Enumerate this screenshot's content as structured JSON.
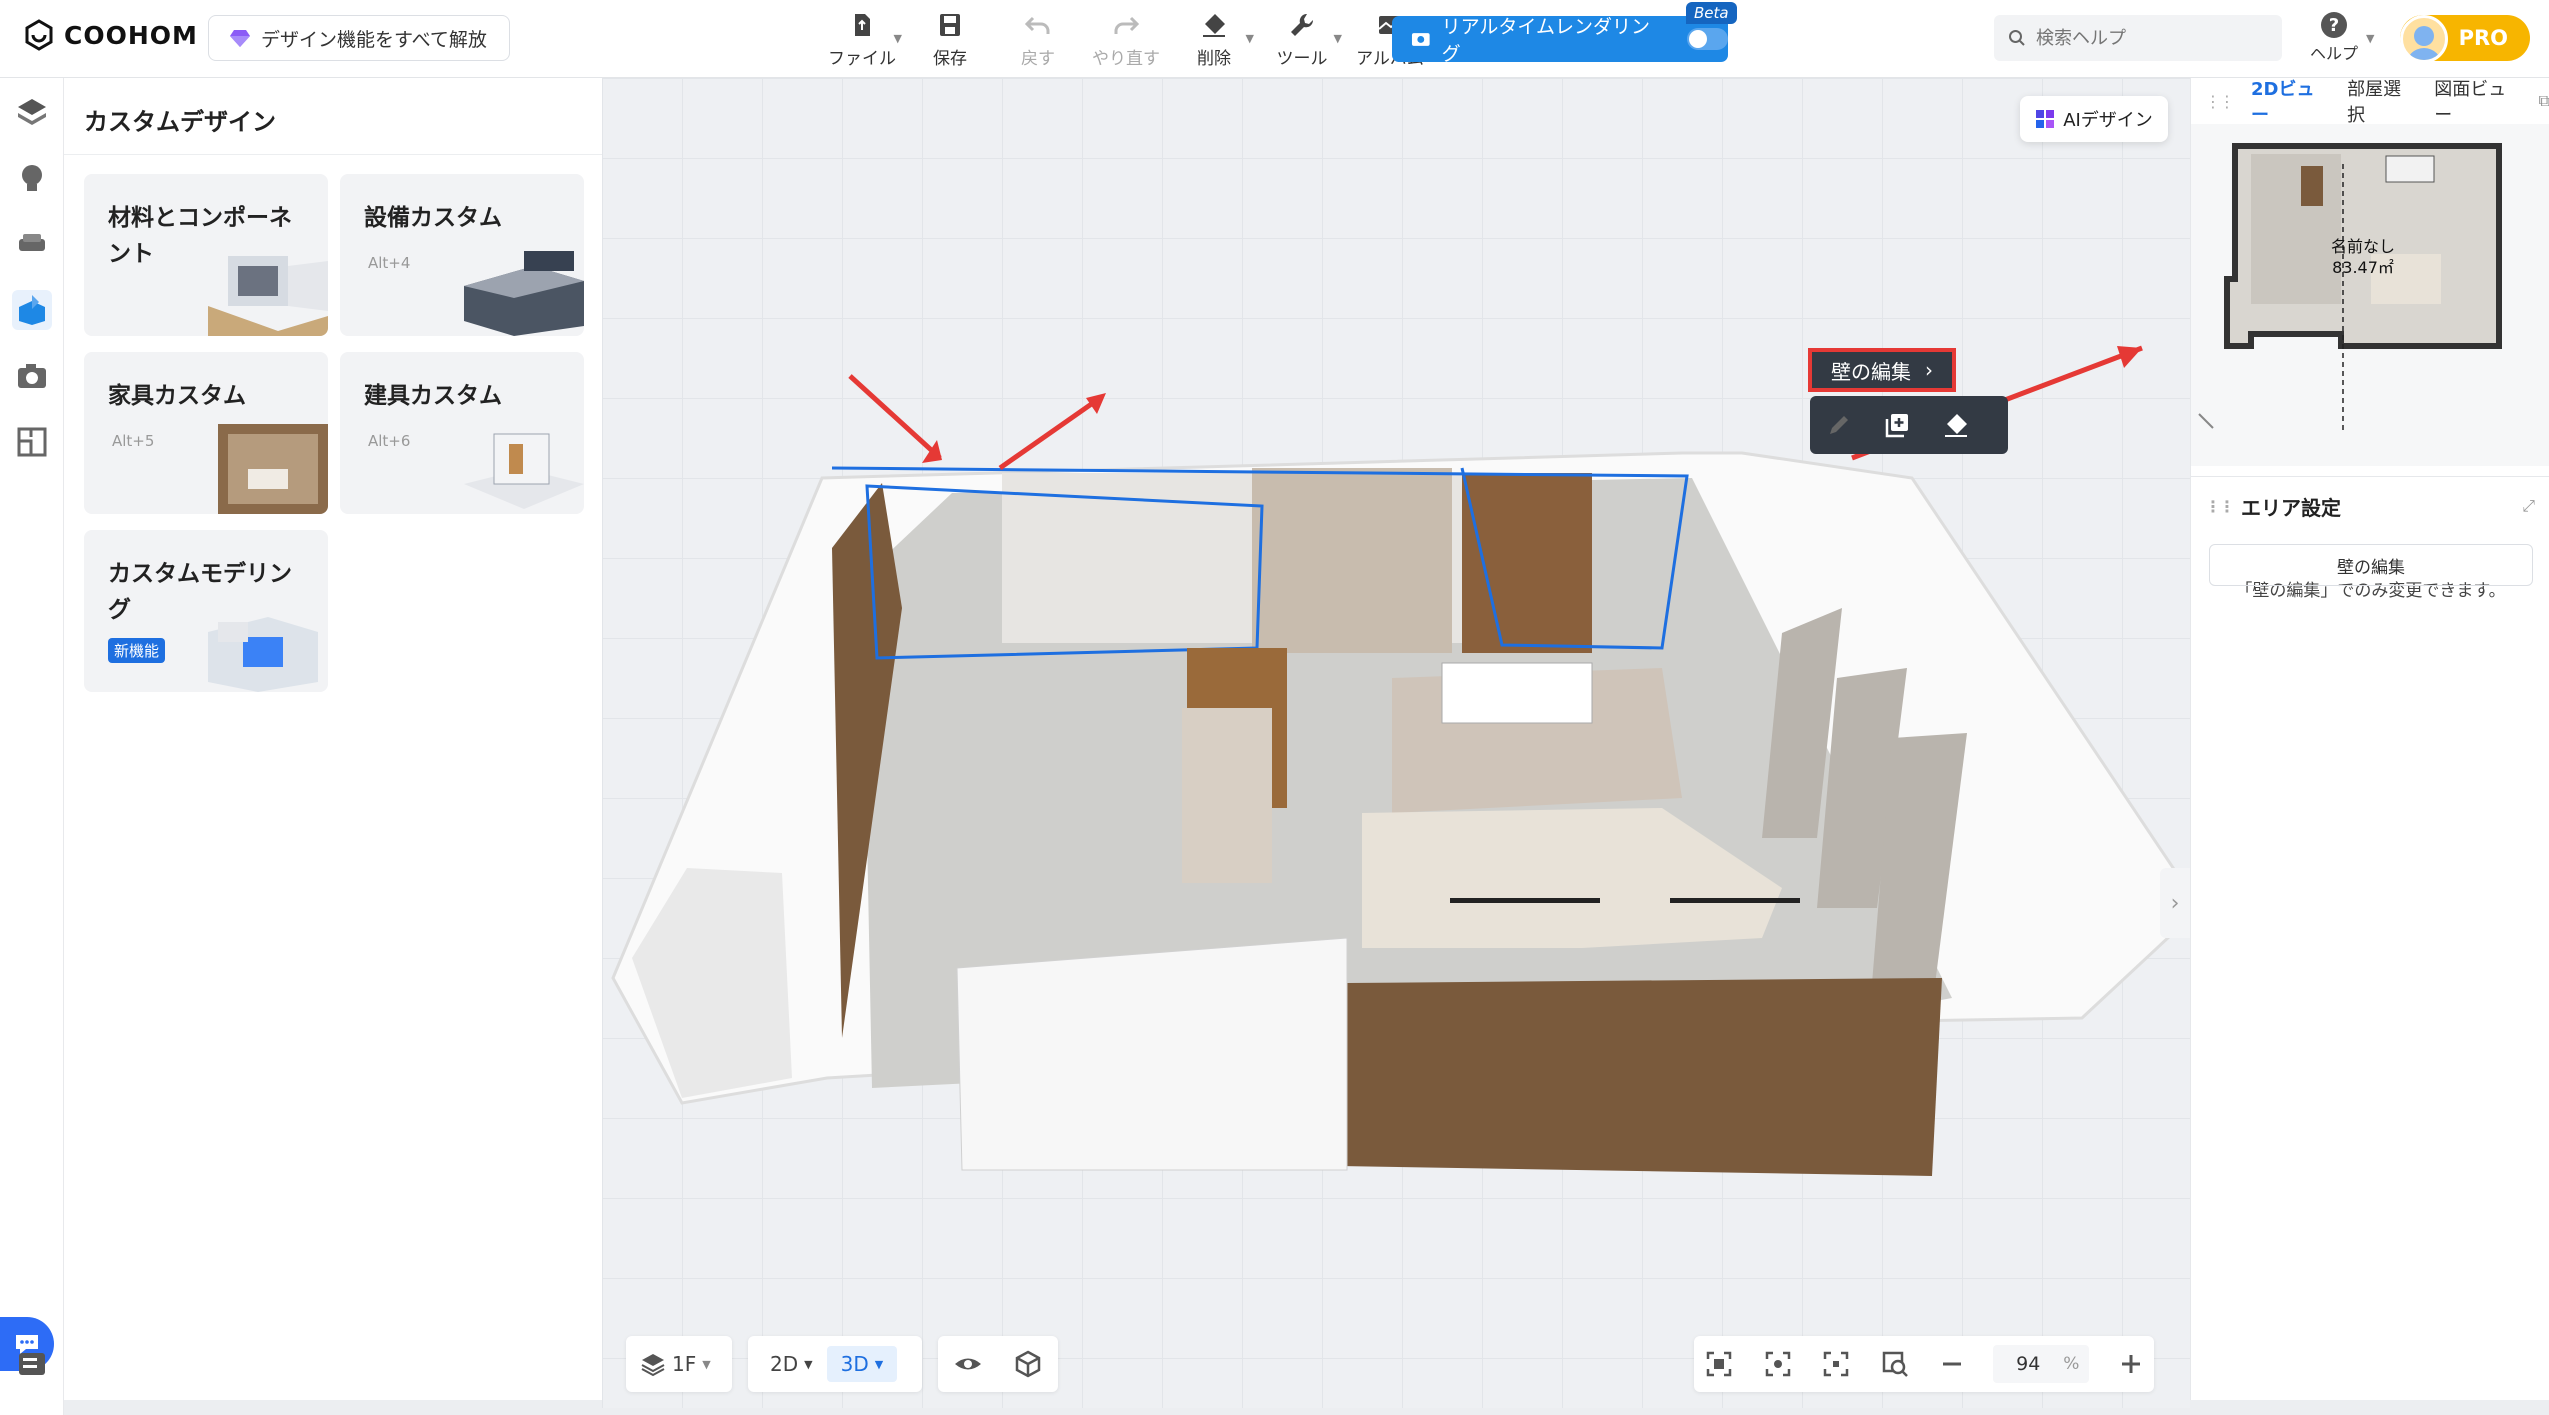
{
  "brand": {
    "name": "COOHOM"
  },
  "unlock_label": "デザイン機能をすべて解放",
  "toolbar": {
    "items": [
      {
        "label": "ファイル",
        "icon": "file-icon",
        "disabled": false
      },
      {
        "label": "保存",
        "icon": "save-icon",
        "disabled": false
      },
      {
        "label": "戻す",
        "icon": "undo-icon",
        "disabled": true
      },
      {
        "label": "やり直す",
        "icon": "redo-icon",
        "disabled": true
      },
      {
        "label": "削除",
        "icon": "eraser-icon",
        "disabled": false
      },
      {
        "label": "ツール",
        "icon": "wrench-icon",
        "disabled": false
      },
      {
        "label": "アルバム",
        "icon": "album-icon",
        "disabled": false
      }
    ],
    "realtime_label": "リアルタイムレンダリング",
    "beta_label": "Beta"
  },
  "search": {
    "placeholder": "検索ヘルプ"
  },
  "help_label": "ヘルプ",
  "pro_label": "PRO",
  "panel": {
    "title": "カスタムデザイン",
    "cards": [
      {
        "title": "材料とコンポーネント",
        "shortcut": ""
      },
      {
        "title": "設備カスタム",
        "shortcut": "Alt+4"
      },
      {
        "title": "家具カスタム",
        "shortcut": "Alt+5"
      },
      {
        "title": "建具カスタム",
        "shortcut": "Alt+6"
      },
      {
        "title": "カスタムモデリング",
        "shortcut": "",
        "badge": "新機能"
      }
    ]
  },
  "canvas": {
    "ai_label": "AIデザイン",
    "wall_edit_label": "壁の編集",
    "floor_label": "1F",
    "view_2d": "2D",
    "view_3d": "3D",
    "zoom": "94",
    "zoom_unit": "%"
  },
  "right": {
    "tabs": [
      "2Dビュー",
      "部屋選択",
      "図面ビュー"
    ],
    "room_name": "名前なし",
    "room_area": "83.47㎡",
    "area_title": "エリア設定",
    "area_note": "「壁の編集」でのみ変更できます。",
    "edit_button": "壁の編集"
  },
  "colors": {
    "accent": "#1e88e5",
    "highlight": "#e53935",
    "pro": "#f7b500"
  }
}
